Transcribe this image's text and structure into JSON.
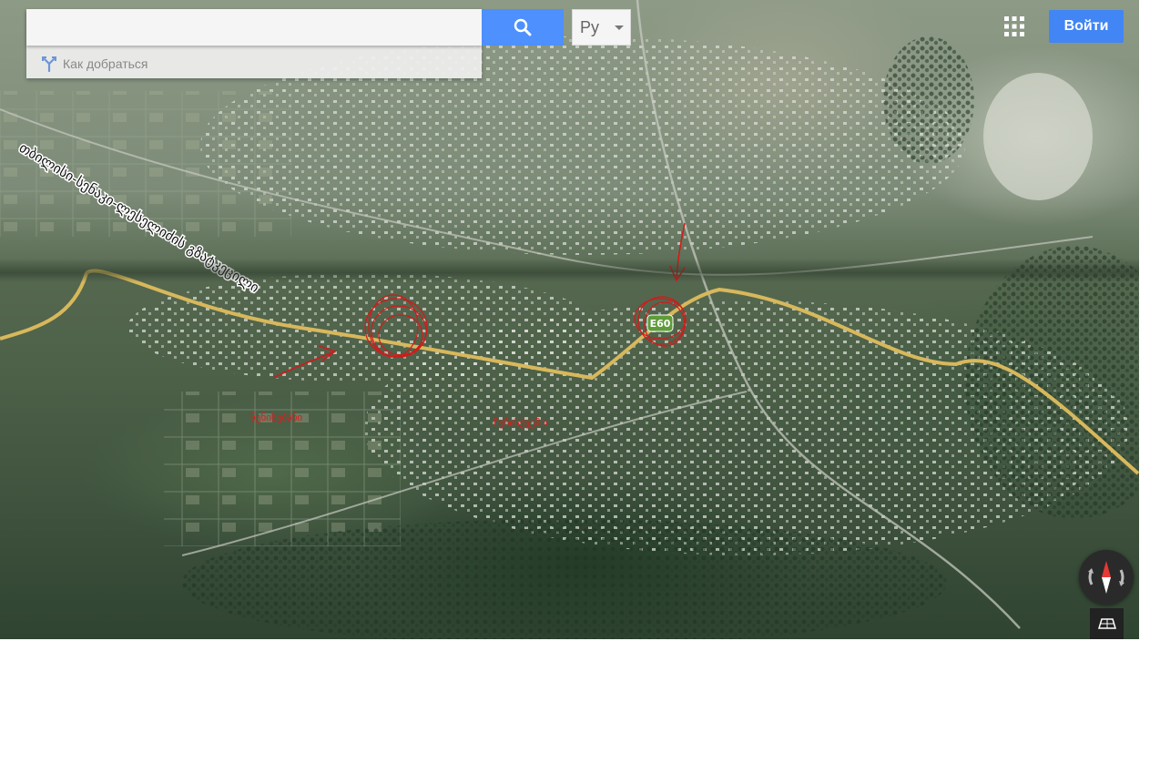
{
  "search": {
    "placeholder": "",
    "value": ""
  },
  "directions": {
    "label": "Как добраться",
    "icon": "directions-icon"
  },
  "search_button": {
    "icon": "search-icon",
    "color": "#4d90fe"
  },
  "language": {
    "selected": "Ру"
  },
  "header": {
    "apps_icon": "apps-grid-icon",
    "login_label": "Войти",
    "login_color": "#4285f4"
  },
  "map": {
    "road_label": "თბილისი-სენაკი-ლესელიძის გზატკეცილი",
    "route_shield": "E60",
    "annotations": [
      {
        "text": "ნუნისუბანი"
      },
      {
        "text": "ნუნისქვემო"
      }
    ],
    "controls": {
      "compass_icon": "compass-icon",
      "tilt_icon": "tilt-3d-icon"
    }
  }
}
